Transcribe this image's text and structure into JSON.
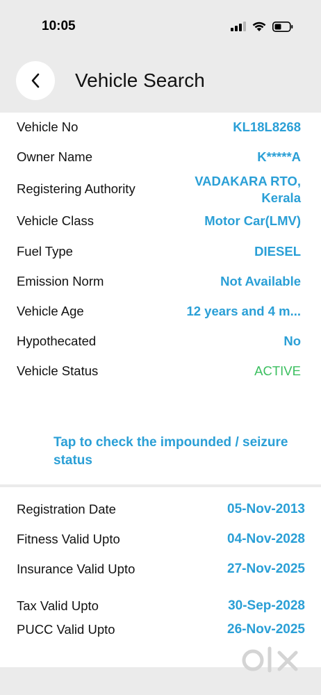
{
  "status_bar": {
    "time": "10:05"
  },
  "header": {
    "title": "Vehicle Search"
  },
  "vehicle_details": [
    {
      "label": "Vehicle No",
      "value": "KL18L8268"
    },
    {
      "label": "Owner Name",
      "value": "K*****A"
    },
    {
      "label": "Registering Authority",
      "value": "VADAKARA RTO, Kerala"
    },
    {
      "label": "Vehicle Class",
      "value": "Motor Car(LMV)"
    },
    {
      "label": "Fuel Type",
      "value": "DIESEL"
    },
    {
      "label": "Emission Norm",
      "value": "Not Available"
    },
    {
      "label": "Vehicle Age",
      "value": "12 years and 4 m..."
    },
    {
      "label": "Hypothecated",
      "value": "No"
    },
    {
      "label": "Vehicle Status",
      "value": "ACTIVE"
    }
  ],
  "impound_link": "Tap to check the impounded / seizure status",
  "validity_dates": [
    {
      "label": "Registration Date",
      "value": "05-Nov-2013"
    },
    {
      "label": "Fitness Valid Upto",
      "value": "04-Nov-2028"
    },
    {
      "label": "Insurance Valid Upto",
      "value": "27-Nov-2025"
    },
    {
      "label": "Tax Valid Upto",
      "value": "30-Sep-2028"
    },
    {
      "label": "PUCC Valid Upto",
      "value": "26-Nov-2025"
    }
  ],
  "colors": {
    "accent": "#2a9fd6",
    "status_active": "#3bbf5f",
    "background": "#ebebeb"
  },
  "icons": {
    "back": "chevron-left-icon",
    "signal": "cellular-signal-icon",
    "wifi": "wifi-icon",
    "battery": "battery-icon"
  }
}
